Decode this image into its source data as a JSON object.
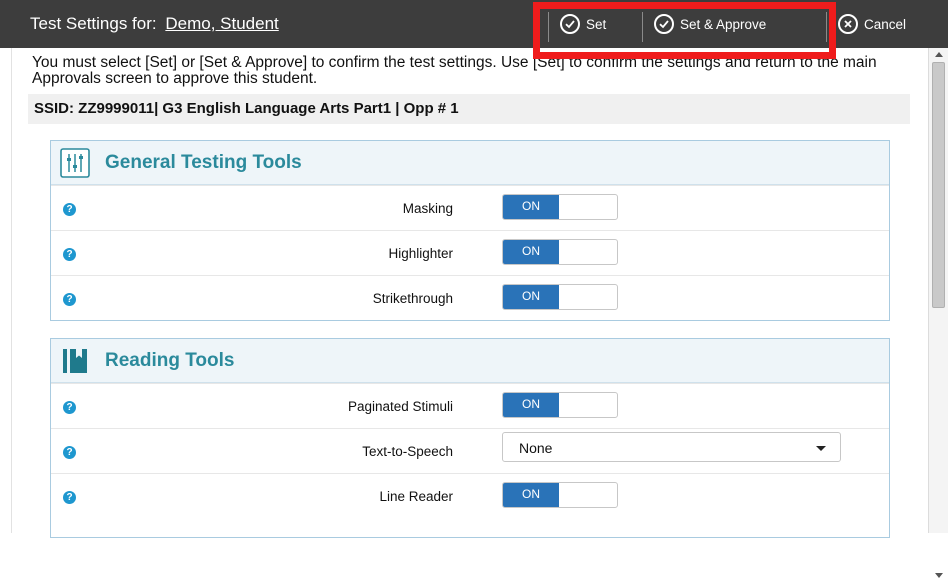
{
  "header": {
    "title_prefix": "Test Settings for:",
    "student_name": "Demo, Student",
    "set_label": "Set",
    "set_approve_label": "Set & Approve",
    "cancel_label": "Cancel"
  },
  "message": "You must select [Set] or [Set & Approve] to confirm the test settings. Use [Set] to confirm the settings and return to the main Approvals screen to approve this student.",
  "ssid_line": "SSID: ZZ9999011| G3 English Language Arts Part1 | Opp # 1",
  "general_tools": {
    "title": "General Testing Tools",
    "icon": "sliders-icon",
    "rows": [
      {
        "label": "Masking",
        "control": "toggle",
        "value": "ON"
      },
      {
        "label": "Highlighter",
        "control": "toggle",
        "value": "ON"
      },
      {
        "label": "Strikethrough",
        "control": "toggle",
        "value": "ON"
      }
    ]
  },
  "reading_tools": {
    "title": "Reading Tools",
    "icon": "book-icon",
    "rows": [
      {
        "label": "Paginated Stimuli",
        "control": "toggle",
        "value": "ON"
      },
      {
        "label": "Text-to-Speech",
        "control": "select",
        "value": "None"
      },
      {
        "label": "Line Reader",
        "control": "toggle",
        "value": "ON"
      }
    ]
  },
  "help_glyph": "?",
  "colors": {
    "header_bg": "#3d3d3d",
    "highlight_box": "#ef1c1c",
    "panel_title": "#2b8a9c",
    "toggle_on": "#2a73b8",
    "help_icon": "#1e97cf"
  }
}
